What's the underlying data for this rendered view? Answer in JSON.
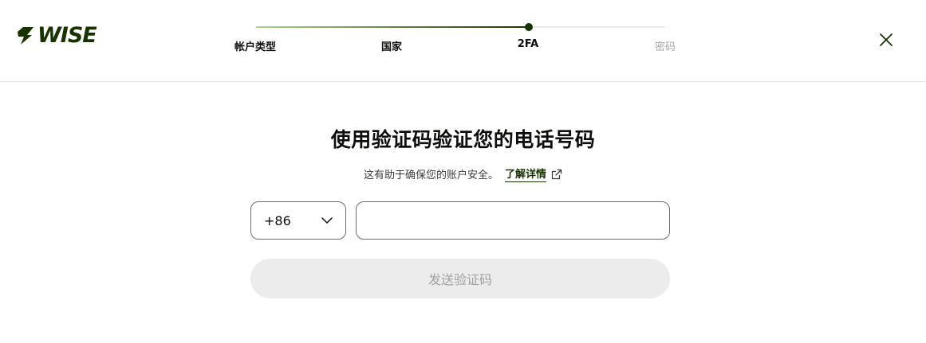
{
  "brand": {
    "name": "WISE",
    "color": "#163300"
  },
  "stepper": {
    "steps": [
      {
        "label": "帐户类型",
        "state": "done"
      },
      {
        "label": "国家",
        "state": "done"
      },
      {
        "label": "2FA",
        "state": "current"
      },
      {
        "label": "密码",
        "state": "upcoming"
      }
    ],
    "progress_step_index": 2
  },
  "header": {
    "close_icon": "close-icon"
  },
  "main": {
    "title": "使用验证码验证您的电话号码",
    "subtitle": "这有助于确保您的账户安全。",
    "learn_more": {
      "label": "了解详情",
      "icon": "external-link-icon"
    },
    "country_select": {
      "value": "+86",
      "icon": "chevron-down-icon"
    },
    "phone_input": {
      "value": "",
      "placeholder": ""
    },
    "send_button": {
      "label": "发送验证码",
      "disabled": true
    }
  },
  "colors": {
    "accent": "#163300",
    "progress_start": "#a5d88a",
    "disabled_bg": "#ececec",
    "disabled_text": "#a0a29e",
    "border": "#6b6e69"
  }
}
